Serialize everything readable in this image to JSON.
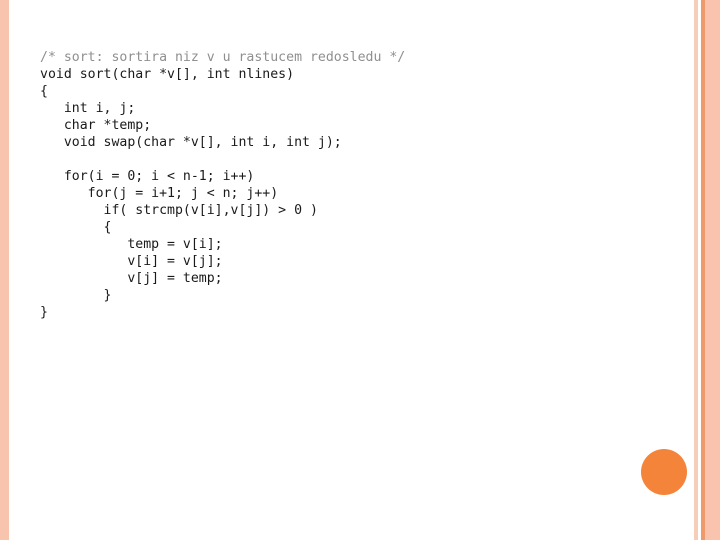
{
  "slide": {
    "background_color": "#ffffff",
    "accent_colors": {
      "stripe_light": "#f8c4ae",
      "stripe_pale": "#f6cdb8",
      "stripe_dark": "#ef9a6b",
      "stripe_wide": "#fac3ad",
      "dot": "#f4843a"
    }
  },
  "code": {
    "language": "c",
    "comment_color": "#8f8f8f",
    "text_color": "#1a1a1a",
    "lines": [
      {
        "id": "line-1",
        "text": "/* sort: sortira niz v u rastucem redosledu */",
        "style": "comment"
      },
      {
        "id": "line-2",
        "text": "void sort(char *v[], int nlines)",
        "style": "plain"
      },
      {
        "id": "line-3",
        "text": "{",
        "style": "plain"
      },
      {
        "id": "line-4",
        "text": "   int i, j;",
        "style": "plain"
      },
      {
        "id": "line-5",
        "text": "   char *temp;",
        "style": "plain"
      },
      {
        "id": "line-6",
        "text": "   void swap(char *v[], int i, int j);",
        "style": "plain"
      },
      {
        "id": "line-7",
        "text": "",
        "style": "plain"
      },
      {
        "id": "line-8",
        "text": "   for(i = 0; i < n-1; i++)",
        "style": "plain"
      },
      {
        "id": "line-9",
        "text": "      for(j = i+1; j < n; j++)",
        "style": "plain"
      },
      {
        "id": "line-10",
        "text": "        if( strcmp(v[i],v[j]) > 0 )",
        "style": "plain"
      },
      {
        "id": "line-11",
        "text": "        {",
        "style": "plain"
      },
      {
        "id": "line-12",
        "text": "           temp = v[i];",
        "style": "plain"
      },
      {
        "id": "line-13",
        "text": "           v[i] = v[j];",
        "style": "plain"
      },
      {
        "id": "line-14",
        "text": "           v[j] = temp;",
        "style": "plain"
      },
      {
        "id": "line-15",
        "text": "        }",
        "style": "plain"
      },
      {
        "id": "line-16",
        "text": "}",
        "style": "plain"
      }
    ]
  }
}
